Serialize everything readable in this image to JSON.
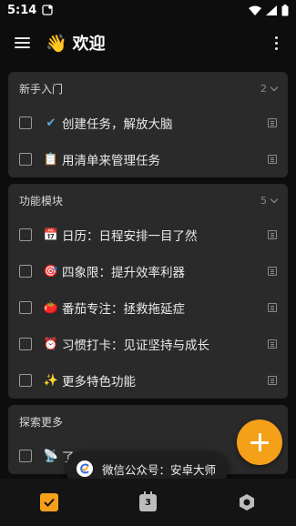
{
  "status_bar": {
    "time": "5:14"
  },
  "header": {
    "emoji": "👋",
    "title": "欢迎"
  },
  "sections": [
    {
      "title": "新手入门",
      "count": "2",
      "tasks": [
        {
          "icon": "✔",
          "text": "创建任务，解放大脑"
        },
        {
          "icon": "📋",
          "text": "用清单来管理任务"
        }
      ]
    },
    {
      "title": "功能模块",
      "count": "5",
      "tasks": [
        {
          "icon": "📅",
          "text": "日历：日程安排一目了然"
        },
        {
          "icon": "🎯",
          "text": "四象限：提升效率利器"
        },
        {
          "icon": "🍅",
          "text": "番茄专注：拯救拖延症"
        },
        {
          "icon": "⏰",
          "text": "习惯打卡：见证坚持与成长"
        },
        {
          "icon": "✨",
          "text": "更多特色功能"
        }
      ]
    },
    {
      "title": "探索更多",
      "tasks": [
        {
          "icon": "📡",
          "text": "了"
        }
      ]
    }
  ],
  "toast": {
    "text": "微信公众号：安卓大师"
  },
  "bottom_nav": {
    "calendar_day": "3"
  },
  "colors": {
    "accent": "#f5a019",
    "card": "#2a2a2a",
    "background": "#0d0d0d"
  }
}
